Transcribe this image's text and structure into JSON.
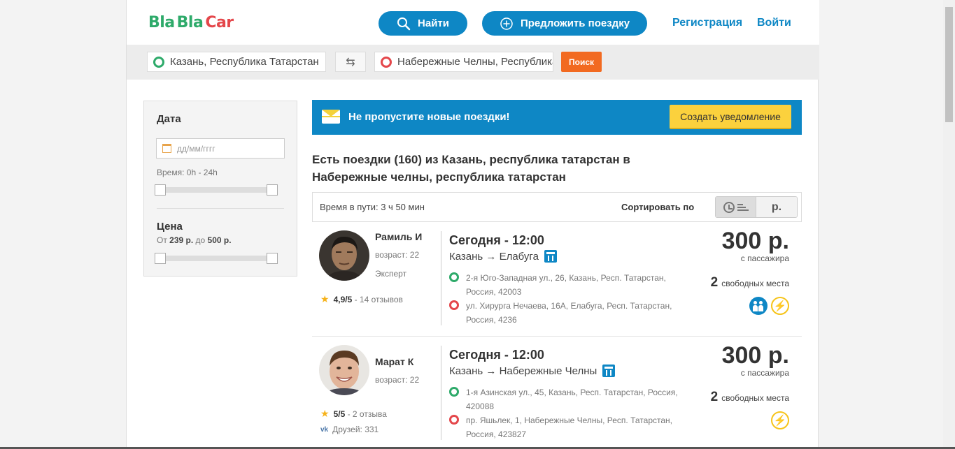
{
  "header": {
    "logo": {
      "part1": "Bla",
      "part2": "Bla",
      "part3": "Car"
    },
    "find_label": "Найти",
    "offer_label": "Предложить поездку",
    "register_label": "Регистрация",
    "login_label": "Войти"
  },
  "search": {
    "from_value": "Казань, Республика Татарстан",
    "to_value": "Набережные Челны, Республика Татарстан",
    "swap_icon": "⇆",
    "submit_label": "Поиск"
  },
  "filters": {
    "date_title": "Дата",
    "date_placeholder": "дд/мм/гггг",
    "time_label": "Время: 0h - 24h",
    "price_title": "Цена",
    "price_from_prefix": "От ",
    "price_min": "239 р.",
    "price_mid": " до ",
    "price_max": "500 р."
  },
  "alert_banner": {
    "text": "Не пропустите новые поездки!",
    "button_label": "Создать уведомление"
  },
  "results": {
    "title": "Есть поездки (160) из Казань, республика татарстан в Набережные челны, республика татарстан",
    "travel_time": "Время в пути: 3 ч 50 мин",
    "sort_label": "Сортировать по",
    "sort_price_label": "р."
  },
  "trips": [
    {
      "driver_name": "Рамиль И",
      "age": "возраст: 22",
      "level": "Эксперт",
      "rating": "4,9/5",
      "reviews": " - 14 отзывов",
      "date": "Сегодня - 12:00",
      "route": "Казань → Елабуга",
      "pickup": "2-я Юго-Западная ул., 26, Казань, Респ. Татарстан, Россия, 42003",
      "dropoff": "ул. Хирурга Нечаева, 16А, Елабуга, Респ. Татарстан, Россия, 4236",
      "price": "300 р.",
      "per_passenger": "с пассажира",
      "seats_count": "2",
      "seats_label": "свободных места"
    },
    {
      "driver_name": "Марат К",
      "age": "возраст: 22",
      "rating": "5/5",
      "reviews": " - 2 отзыва",
      "friends": "Друзей: 331",
      "date": "Сегодня - 12:00",
      "route": "Казань → Набережные Челны",
      "pickup": "1-я Азинская ул., 45, Казань, Респ. Татарстан, Россия, 420088",
      "dropoff": "пр. Яшьлек, 1, Набережные Челны, Респ. Татарстан, Россия, 423827",
      "price": "300 р.",
      "per_passenger": "с пассажира",
      "seats_count": "2",
      "seats_label": "свободных места"
    }
  ],
  "colors": {
    "brand_blue": "#0e87c5",
    "brand_green": "#2eaa6a",
    "brand_red": "#e4474b",
    "search_orange": "#f26a21",
    "alert_yellow": "#fbd13d"
  }
}
